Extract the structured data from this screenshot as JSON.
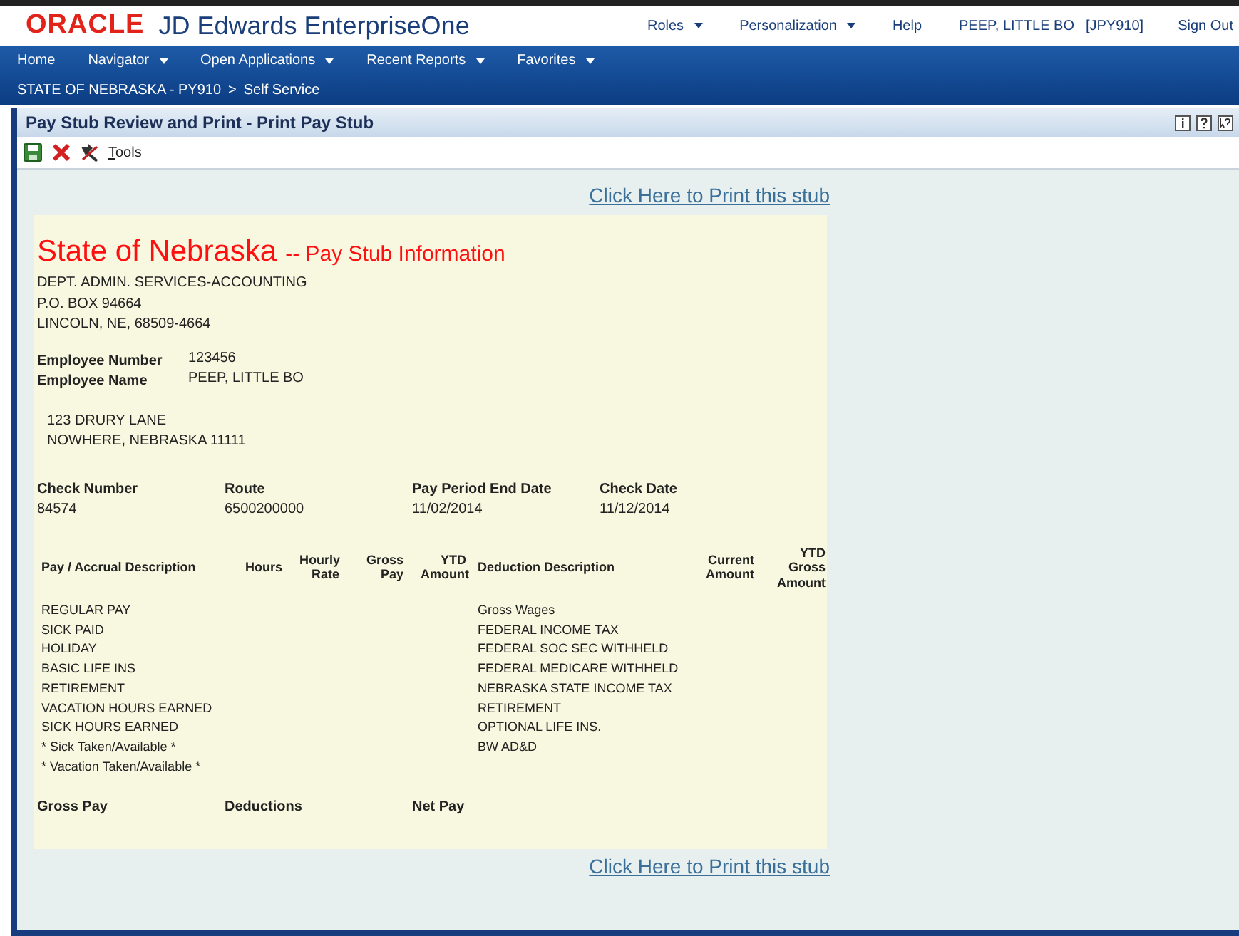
{
  "header": {
    "brand": "ORACLE",
    "product": "JD Edwards EnterpriseOne",
    "menus": [
      {
        "label": "Roles",
        "dropdown": true
      },
      {
        "label": "Personalization",
        "dropdown": true
      },
      {
        "label": "Help",
        "dropdown": false
      }
    ],
    "user": "PEEP, LITTLE BO",
    "environment": "[JPY910]",
    "sign_out": "Sign Out"
  },
  "nav": {
    "items": [
      {
        "label": "Home",
        "dropdown": false
      },
      {
        "label": "Navigator",
        "dropdown": true
      },
      {
        "label": "Open Applications",
        "dropdown": true
      },
      {
        "label": "Recent Reports",
        "dropdown": true
      },
      {
        "label": "Favorites",
        "dropdown": true
      }
    ],
    "breadcrumb": [
      "STATE OF NEBRASKA - PY910",
      ">",
      "Self Service"
    ]
  },
  "title": "Pay Stub Review and Print - Print Pay Stub",
  "toolbar": {
    "tools": "Tools"
  },
  "print_link_top": "Click Here to Print this stub",
  "stub": {
    "title": "State of Nebraska",
    "subtitle": "-- Pay Stub Information",
    "employer_address": [
      "DEPT. ADMIN. SERVICES-ACCOUNTING",
      "P.O. BOX 94664",
      "LINCOLN, NE, 68509-4664"
    ],
    "employee": [
      {
        "label": "Employee Number",
        "value": "123456"
      },
      {
        "label": "Employee Name",
        "value": "PEEP, LITTLE BO"
      }
    ],
    "employee_address": [
      "123 DRURY LANE",
      "NOWHERE, NEBRASKA 11111"
    ],
    "check": [
      {
        "label": "Check Number",
        "value": "84574"
      },
      {
        "label": "Route",
        "value": "6500200000"
      },
      {
        "label": "Pay Period End Date",
        "value": "11/02/2014"
      },
      {
        "label": "Check Date",
        "value": "11/12/2014"
      }
    ],
    "columns": [
      "Pay / Accrual Description",
      "Hours",
      "Hourly Rate",
      "Gross Pay",
      "YTD Amount",
      "Deduction Description",
      "Current Amount",
      "YTD Gross Amount"
    ],
    "pay_rows": [
      "REGULAR PAY",
      "SICK PAID",
      "HOLIDAY",
      "BASIC LIFE INS",
      "RETIREMENT",
      "VACATION HOURS EARNED",
      "SICK HOURS EARNED",
      "* Sick Taken/Available *",
      "* Vacation Taken/Available *"
    ],
    "deduction_rows": [
      "Gross Wages",
      "FEDERAL INCOME TAX",
      "FEDERAL SOC SEC WITHHELD",
      "FEDERAL MEDICARE WITHHELD",
      "NEBRASKA STATE INCOME TAX",
      "RETIREMENT",
      "OPTIONAL LIFE INS.",
      "BW AD&D"
    ],
    "totals": [
      "Gross Pay",
      "Deductions",
      "Net Pay"
    ]
  },
  "print_link_bottom": "Click Here to Print this stub"
}
